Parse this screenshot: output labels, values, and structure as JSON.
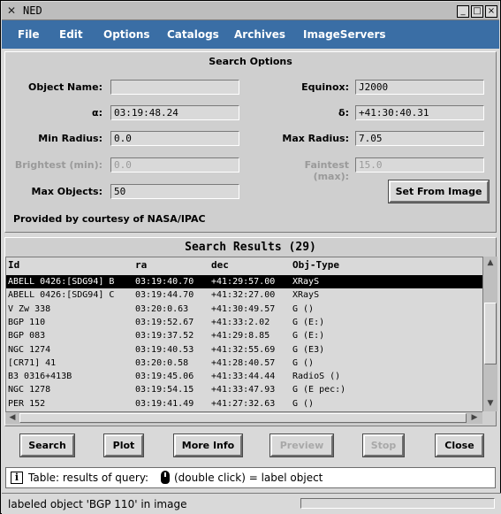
{
  "window": {
    "title": "NED",
    "app_icon": "x-icon",
    "controls": {
      "minimize": "_",
      "maximize": "□",
      "close": "×"
    }
  },
  "menubar": {
    "items": [
      "File",
      "Edit",
      "Options",
      "Catalogs",
      "Archives",
      "ImageServers"
    ]
  },
  "search_options": {
    "title": "Search Options",
    "fields": {
      "object_name": {
        "label": "Object Name:",
        "value": ""
      },
      "equinox": {
        "label": "Equinox:",
        "value": "J2000"
      },
      "alpha": {
        "label": "α:",
        "value": "03:19:48.24"
      },
      "delta": {
        "label": "δ:",
        "value": "+41:30:40.31"
      },
      "min_radius": {
        "label": "Min Radius:",
        "value": "0.0"
      },
      "max_radius": {
        "label": "Max Radius:",
        "value": "7.05"
      },
      "brightest": {
        "label": "Brightest (min):",
        "value": "0.0",
        "disabled": true
      },
      "faintest": {
        "label": "Faintest (max):",
        "value": "15.0",
        "disabled": true
      },
      "max_objects": {
        "label": "Max Objects:",
        "value": "50"
      }
    },
    "set_from_image_label": "Set From Image",
    "courtesy": "Provided by courtesy of NASA/IPAC"
  },
  "results": {
    "title": "Search Results (29)",
    "columns": [
      "Id",
      "ra",
      "dec",
      "Obj-Type"
    ],
    "rows": [
      [
        "ABELL 0426:[SDG94] B",
        "03:19:40.70",
        "+41:29:57.00",
        "XRayS"
      ],
      [
        "ABELL 0426:[SDG94] C",
        "03:19:44.70",
        "+41:32:27.00",
        "XRayS"
      ],
      [
        "V Zw 338",
        "03:20:0.63",
        "+41:30:49.57",
        "G ()"
      ],
      [
        "BGP 110",
        "03:19:52.67",
        "+41:33:2.02",
        "G (E:)"
      ],
      [
        "BGP 083",
        "03:19:37.52",
        "+41:29:8.85",
        "G (E:)"
      ],
      [
        "NGC 1274",
        "03:19:40.53",
        "+41:32:55.69",
        "G (E3)"
      ],
      [
        "[CR71] 41",
        "03:20:0.58",
        "+41:28:40.57",
        "G ()"
      ],
      [
        "B3 0316+413B",
        "03:19:45.06",
        "+41:33:44.44",
        "RadioS ()"
      ],
      [
        "NGC 1278",
        "03:19:54.15",
        "+41:33:47.93",
        "G (E pec:)"
      ],
      [
        "PER 152",
        "03:19:41.49",
        "+41:27:32.63",
        "G ()"
      ]
    ],
    "selected_row": 0
  },
  "actions": {
    "search": "Search",
    "plot": "Plot",
    "more_info": "More Info",
    "preview": "Preview",
    "stop": "Stop",
    "close": "Close"
  },
  "status": {
    "info_icon": "i",
    "text_before": "Table: results of query:",
    "text_after": "(double click) = label object",
    "bottom": "labeled object 'BGP 110' in image"
  },
  "colors": {
    "menubar": "#3a6ea5",
    "background": "#d9d9d9",
    "selected_row_bg": "#000000",
    "disabled_text": "#9a9a9a"
  }
}
